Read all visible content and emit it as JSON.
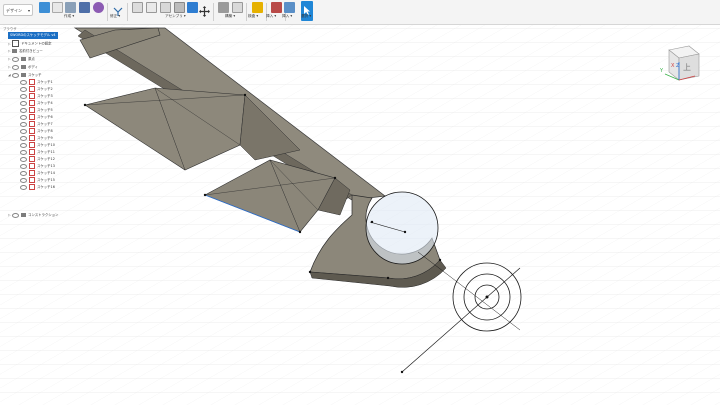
{
  "toolbar": {
    "workspace": "デザイン",
    "groups": [
      {
        "label": "作成 ▾"
      },
      {
        "label": "修正 ▾"
      },
      {
        "label": "アセンブリ ▾"
      },
      {
        "label": "構築 ▾"
      },
      {
        "label": "検査 ▾"
      },
      {
        "label": "挿入 ▾"
      },
      {
        "label": "選択 ▾"
      }
    ]
  },
  "browser": {
    "header": "ブラウザ",
    "root": "SWORDのスケッチモデル v4",
    "items": [
      {
        "label": "ドキュメントの設定"
      },
      {
        "label": "名前付きビュー"
      },
      {
        "label": "原点"
      },
      {
        "label": "ボディ"
      },
      {
        "label": "スケッチ"
      }
    ],
    "sketches": [
      "スケッチ1",
      "スケッチ2",
      "スケッチ3",
      "スケッチ4",
      "スケッチ5",
      "スケッチ6",
      "スケッチ7",
      "スケッチ8",
      "スケッチ9",
      "スケッチ10",
      "スケッチ11",
      "スケッチ12",
      "スケッチ13",
      "スケッチ14",
      "スケッチ15",
      "スケッチ16"
    ],
    "footer": "コンストラクション"
  },
  "viewcube": {
    "face": "上",
    "axis_x": "X",
    "axis_y": "Y",
    "axis_z": "Z"
  }
}
